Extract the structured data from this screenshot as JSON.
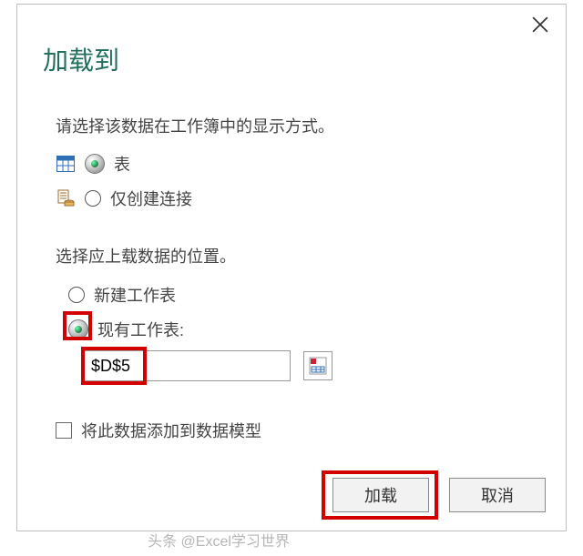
{
  "dialog": {
    "title": "加载到",
    "prompt_display": "请选择该数据在工作簿中的显示方式。",
    "option_table": "表",
    "option_connection_only": "仅创建连接",
    "prompt_location": "选择应上载数据的位置。",
    "option_new_sheet": "新建工作表",
    "option_existing_sheet": "现有工作表:",
    "cell_reference": "$D$5",
    "checkbox_model": "将此数据添加到数据模型",
    "button_load": "加载",
    "button_cancel": "取消"
  },
  "watermark": "头条 @Excel学习世界"
}
